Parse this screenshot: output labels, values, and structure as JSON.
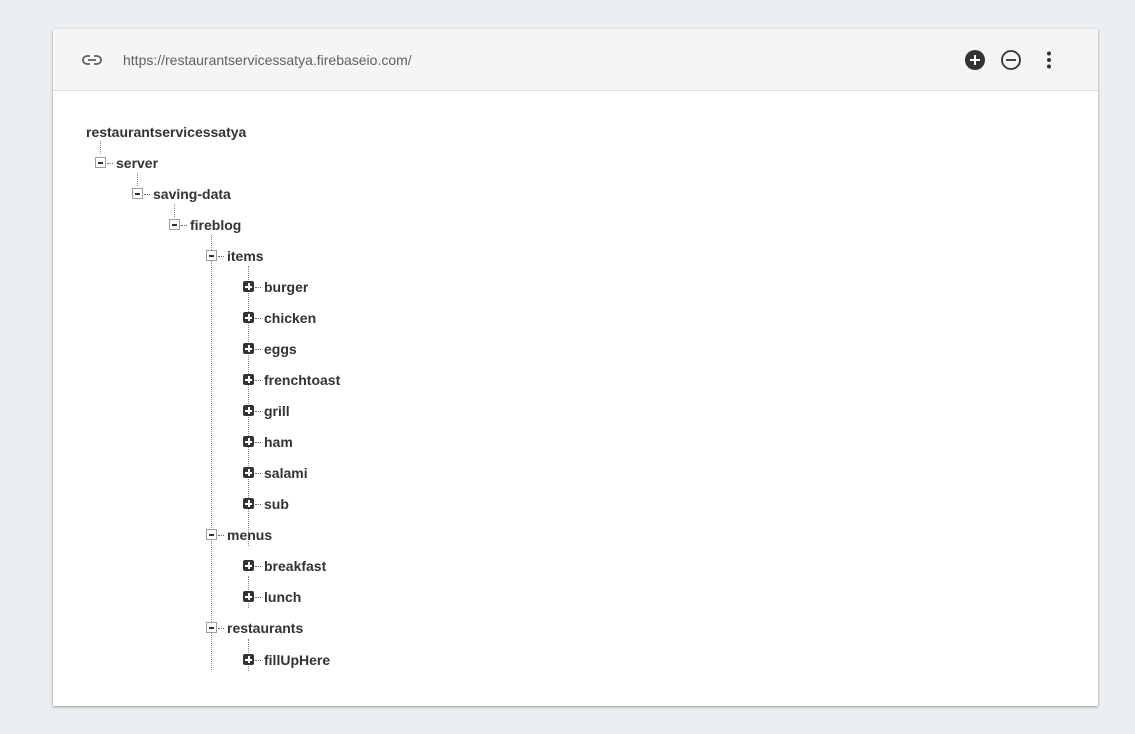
{
  "header": {
    "url": "https://restaurantservicessatya.firebaseio.com/",
    "icons": {
      "link": "link-icon",
      "add": "add-circle-icon",
      "remove": "remove-circle-icon",
      "more": "more-vert-icon"
    }
  },
  "tree": {
    "root": "restaurantservicessatya",
    "server": "server",
    "saving_data": "saving-data",
    "fireblog": "fireblog",
    "items": {
      "label": "items",
      "children": [
        "burger",
        "chicken",
        "eggs",
        "frenchtoast",
        "grill",
        "ham",
        "salami",
        "sub"
      ]
    },
    "menus": {
      "label": "menus",
      "children": [
        "breakfast",
        "lunch"
      ]
    },
    "restaurants": {
      "label": "restaurants",
      "children": [
        "fillUpHere"
      ]
    }
  },
  "colors": {
    "background": "#eceff1",
    "header": "#f5f5f5",
    "text": "#333333",
    "url_text": "#616161"
  }
}
